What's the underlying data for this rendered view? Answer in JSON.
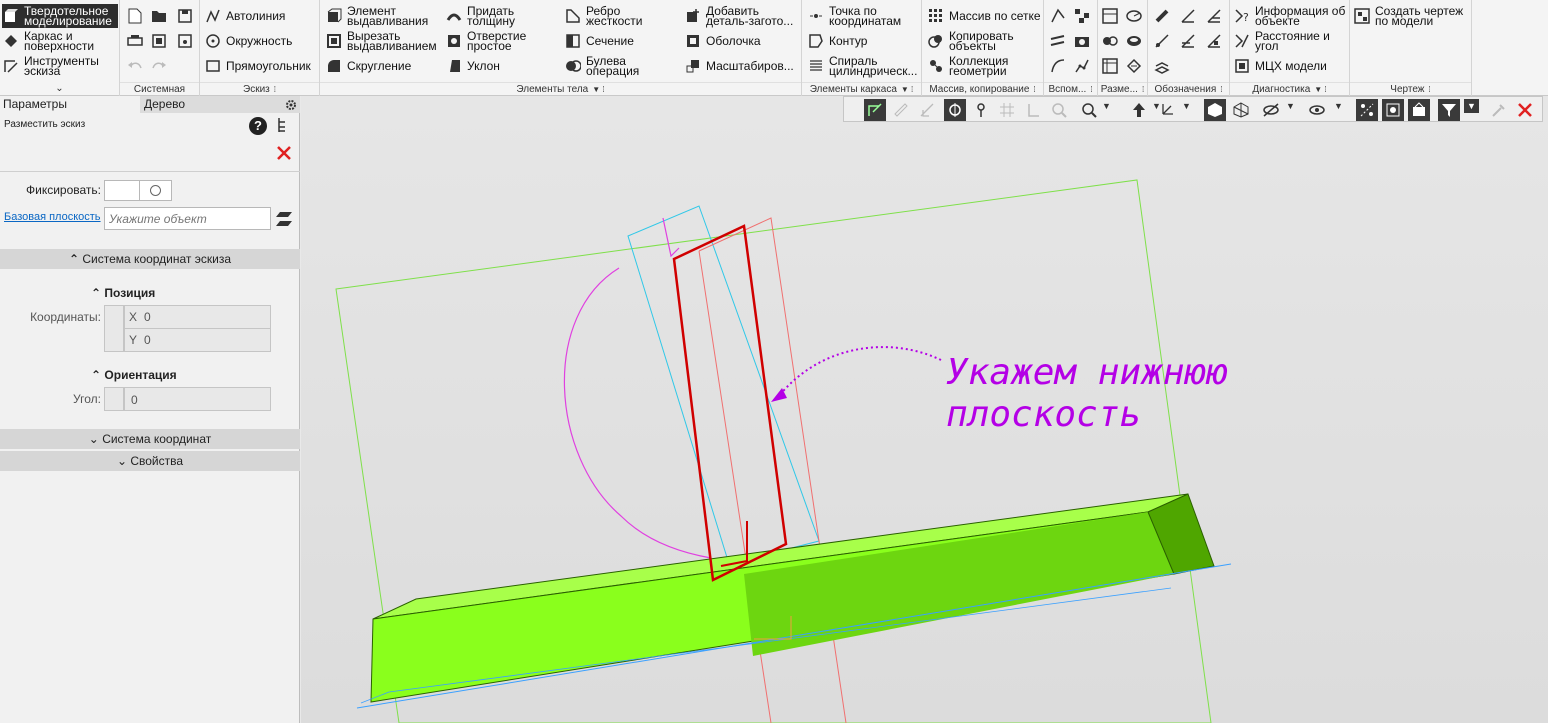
{
  "ribbon": {
    "modes": [
      {
        "label": "Твердотельное моделирование",
        "active": true
      },
      {
        "label": "Каркас и поверхности",
        "active": false
      },
      {
        "label": "Инструменты эскиза",
        "active": false
      }
    ],
    "groups": {
      "system": "Системная",
      "sketch": "Эскиз",
      "body": "Элементы тела",
      "frame": "Элементы каркаса",
      "array": "Массив, копирование",
      "aux": "Вспом...",
      "size": "Разме...",
      "marks": "Обозначения",
      "diag": "Диагностика",
      "drawing": "Чертеж"
    },
    "sketch_tools": [
      "Автолиния",
      "Окружность",
      "Прямоугольник"
    ],
    "body_tools": [
      "Элемент выдавливания",
      "Вырезать выдавливанием",
      "Скругление",
      "Придать толщину",
      "Отверстие простое",
      "Уклон",
      "Ребро жесткости",
      "Сечение",
      "Булева операция",
      "Добавить деталь-загото...",
      "Оболочка",
      "Масштабиров..."
    ],
    "frame_tools": [
      "Точка по координатам",
      "Контур",
      "Спираль цилиндрическ..."
    ],
    "array_tools": [
      "Массив по сетке",
      "Копировать объекты",
      "Коллекция геометрии"
    ],
    "diag_tools": [
      "Информация об объекте",
      "Расстояние и угол",
      "МЦХ модели"
    ],
    "drawing_tools": [
      "Создать чертеж по модели"
    ]
  },
  "panel": {
    "tabs": [
      "Параметры",
      "Дерево"
    ],
    "title": "Разместить эскиз",
    "fix_label": "Фиксировать:",
    "base_plane_label": "Базовая плоскость",
    "base_plane_placeholder": "Укажите объект",
    "sections": {
      "sketch_cs": "Система координат эскиза",
      "position": "Позиция",
      "coords_label": "Координаты:",
      "x_label": "X",
      "x_value": "0",
      "y_label": "Y",
      "y_value": "0",
      "orientation": "Ориентация",
      "angle_label": "Угол:",
      "angle_value": "0",
      "cs": "Система координат",
      "props": "Свойства"
    }
  },
  "annotation": {
    "line1": "Укажем нижнюю",
    "line2": "плоскость",
    "color": "#b400e6"
  },
  "colors": {
    "solid_face": "#8aff1c",
    "solid_dark": "#55b800",
    "sketch_red": "#d00000",
    "arc_magenta": "#e040e0",
    "plane_green": "#7fe04a",
    "axis_cyan": "#30c8e8"
  }
}
